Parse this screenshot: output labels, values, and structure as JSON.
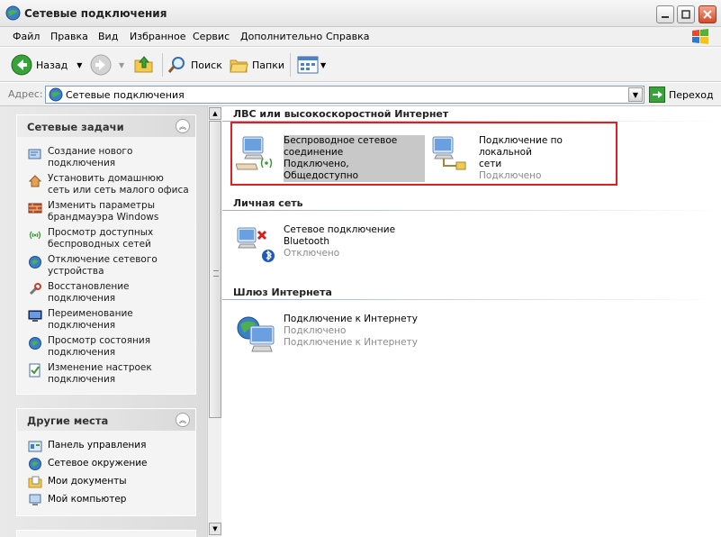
{
  "window": {
    "title": "Сетевые подключения"
  },
  "menu": [
    "Файл",
    "Правка",
    "Вид",
    "Избранное",
    "Сервис",
    "Дополнительно",
    "Справка"
  ],
  "toolbar": {
    "back": "Назад",
    "search": "Поиск",
    "folders": "Папки"
  },
  "address": {
    "label": "Адрес:",
    "value": "Сетевые подключения",
    "go": "Переход"
  },
  "network_tasks": {
    "title": "Сетевые задачи",
    "items": [
      {
        "line1": "Создание нового",
        "line2": "подключения",
        "icon": "new-connection-icon"
      },
      {
        "line1": "Установить домашнюю",
        "line2": "сеть или сеть малого офиса",
        "icon": "home-network-icon"
      },
      {
        "line1": "Изменить параметры",
        "line2": "брандмауэра Windows",
        "icon": "firewall-icon"
      },
      {
        "line1": "Просмотр доступных",
        "line2": "беспроводных сетей",
        "icon": "wireless-icon"
      },
      {
        "line1": "Отключение сетевого",
        "line2": "устройства",
        "icon": "disable-device-icon"
      },
      {
        "line1": "Восстановление",
        "line2": "подключения",
        "icon": "repair-icon"
      },
      {
        "line1": "Переименование",
        "line2": "подключения",
        "icon": "rename-icon"
      },
      {
        "line1": "Просмотр состояния",
        "line2": "подключения",
        "icon": "status-icon"
      },
      {
        "line1": "Изменение настроек",
        "line2": "подключения",
        "icon": "settings-icon"
      }
    ]
  },
  "other_places": {
    "title": "Другие места",
    "items": [
      {
        "label": "Панель управления",
        "icon": "control-panel-icon"
      },
      {
        "label": "Сетевое окружение",
        "icon": "network-places-icon"
      },
      {
        "label": "Мои документы",
        "icon": "my-documents-icon"
      },
      {
        "label": "Мой компьютер",
        "icon": "my-computer-icon"
      }
    ]
  },
  "groups": {
    "lan": {
      "title": "ЛВС или высокоскоростной Интернет",
      "wireless": {
        "name1": "Беспроводное сетевое",
        "name2": "соединение",
        "status": "Подключено, Общедоступно"
      },
      "local": {
        "name1": "Подключение по локальной",
        "name2": "сети",
        "status": "Подключено"
      }
    },
    "personal": {
      "title": "Личная сеть",
      "bluetooth": {
        "name1": "Сетевое подключение",
        "name2": "Bluetooth",
        "status": "Отключено"
      }
    },
    "gateway": {
      "title": "Шлюз Интернета",
      "internet": {
        "name": "Подключение к Интернету",
        "status": "Подключено",
        "detail": "Подключение к Интернету"
      }
    }
  },
  "colors": {
    "highlight_border": "#e02020",
    "selection_bg": "#c8c8c8"
  }
}
